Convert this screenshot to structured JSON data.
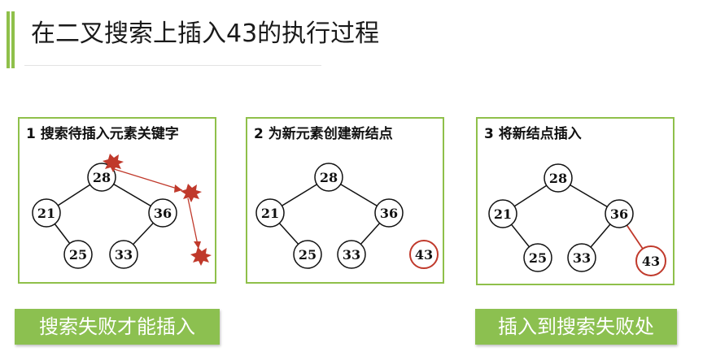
{
  "title": "在二叉搜索上插入43的执行过程",
  "colors": {
    "accent": "#8fc04a",
    "button_bg": "#8cc050",
    "highlight": "#c0392b",
    "star": "#c0392b"
  },
  "steps": [
    {
      "title": "1 搜索待插入元素关键字",
      "nodes": {
        "root": "28",
        "left": "21",
        "right": "36",
        "left_right": "25",
        "right_left": "33"
      }
    },
    {
      "title": "2 为新元素创建新结点",
      "nodes": {
        "root": "28",
        "left": "21",
        "right": "36",
        "left_right": "25",
        "right_left": "33",
        "new": "43"
      }
    },
    {
      "title": "3 将新结点插入",
      "nodes": {
        "root": "28",
        "left": "21",
        "right": "36",
        "left_right": "25",
        "right_left": "33",
        "new": "43"
      }
    }
  ],
  "buttons": {
    "search_fail": "搜索失败才能插入",
    "insert_at_fail": "插入到搜索失败处"
  }
}
